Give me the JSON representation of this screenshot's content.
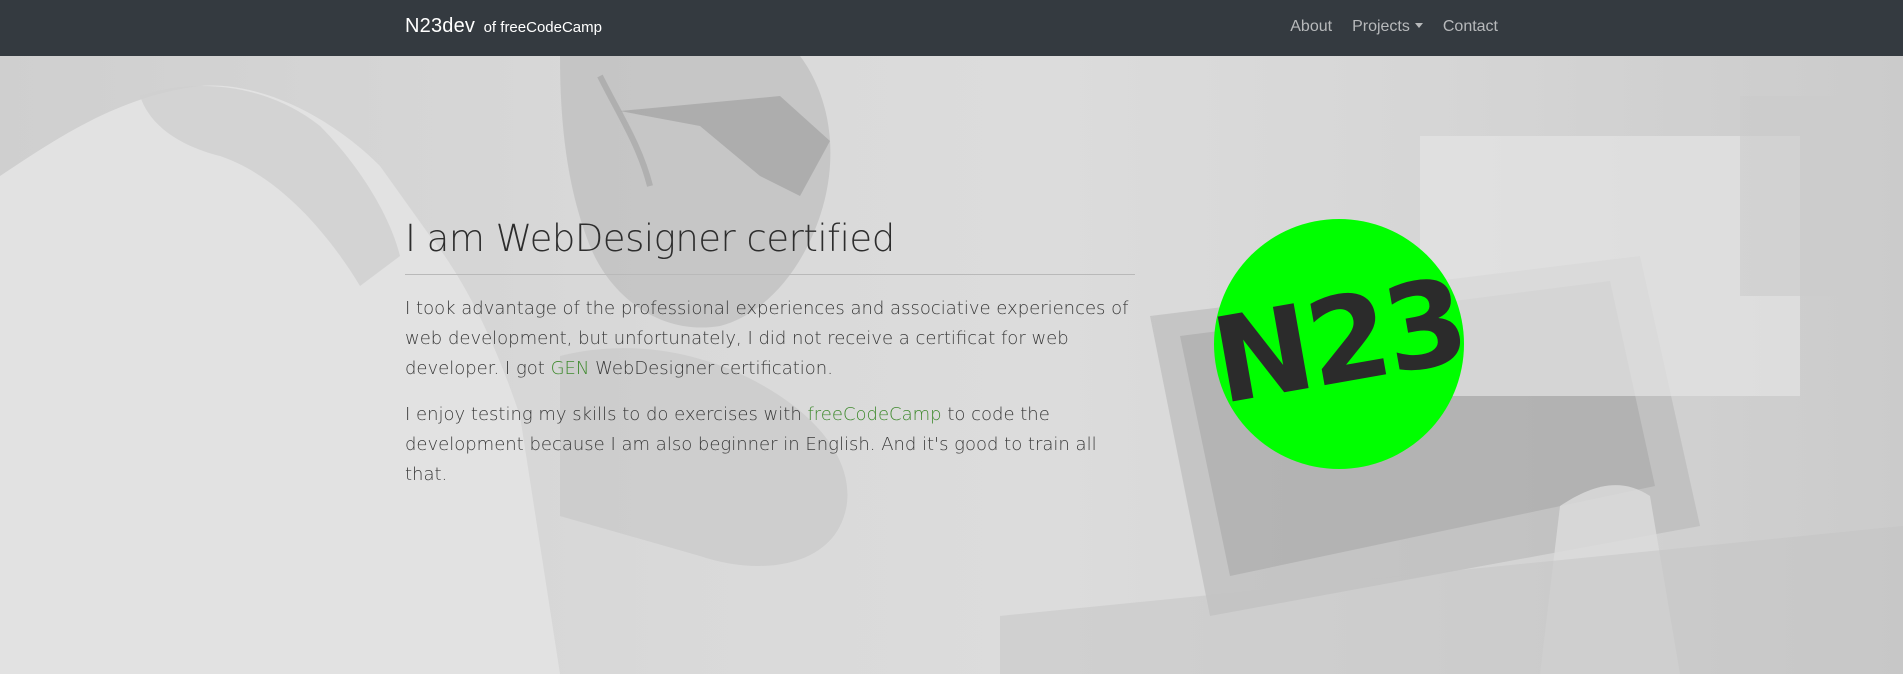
{
  "navbar": {
    "brand": "N23dev",
    "brand_suffix": "of freeCodeCamp",
    "links": [
      {
        "label": "About"
      },
      {
        "label": "Projects"
      },
      {
        "label": "Contact"
      }
    ]
  },
  "hero": {
    "title": "I am WebDesigner certified",
    "paragraph1": {
      "before": "I took advantage of the professional experiences and associative experiences of web development, but unfortunately, I did not receive a certificat for web developer. I got ",
      "link": "GEN",
      "after": " WebDesigner certification."
    },
    "paragraph2": {
      "before": "I enjoy testing my skills to do exercises with ",
      "link": "freeCodeCamp",
      "after": " to code the development because I am also beginner in English. And it's good to train all that."
    }
  },
  "logo": {
    "text": "N23",
    "background_color": "#00ff00",
    "text_color": "#2b2b2b"
  },
  "colors": {
    "navbar_bg": "#343a40",
    "link_green": "#3f8a2e"
  }
}
